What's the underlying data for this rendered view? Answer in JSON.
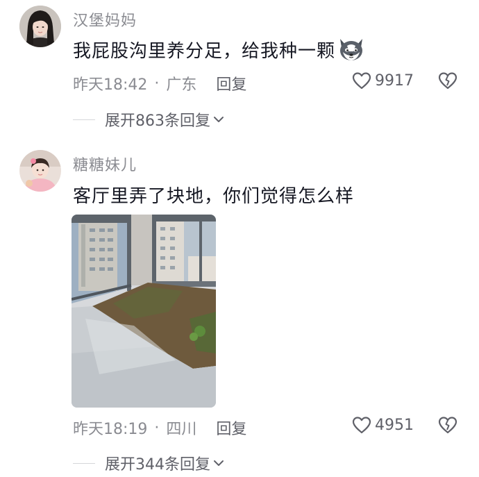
{
  "comments": [
    {
      "username": "汉堡妈妈",
      "text": "我屁股沟里养分足，给我种一颗",
      "emoji_icon": "husky-dog-face-icon",
      "time": "昨天18:42",
      "separator": "·",
      "location": "广东",
      "reply_label": "回复",
      "likes": "9917",
      "expand_label": "展开863条回复"
    },
    {
      "username": "糖糖妹儿",
      "text": "客厅里弄了块地，你们觉得怎么样",
      "time": "昨天18:19",
      "separator": "·",
      "location": "四川",
      "reply_label": "回复",
      "likes": "4951",
      "expand_label": "展开344条回复"
    }
  ],
  "colors": {
    "text_primary": "#161823",
    "text_secondary": "#8a8b91",
    "text_action": "#5f6068"
  }
}
